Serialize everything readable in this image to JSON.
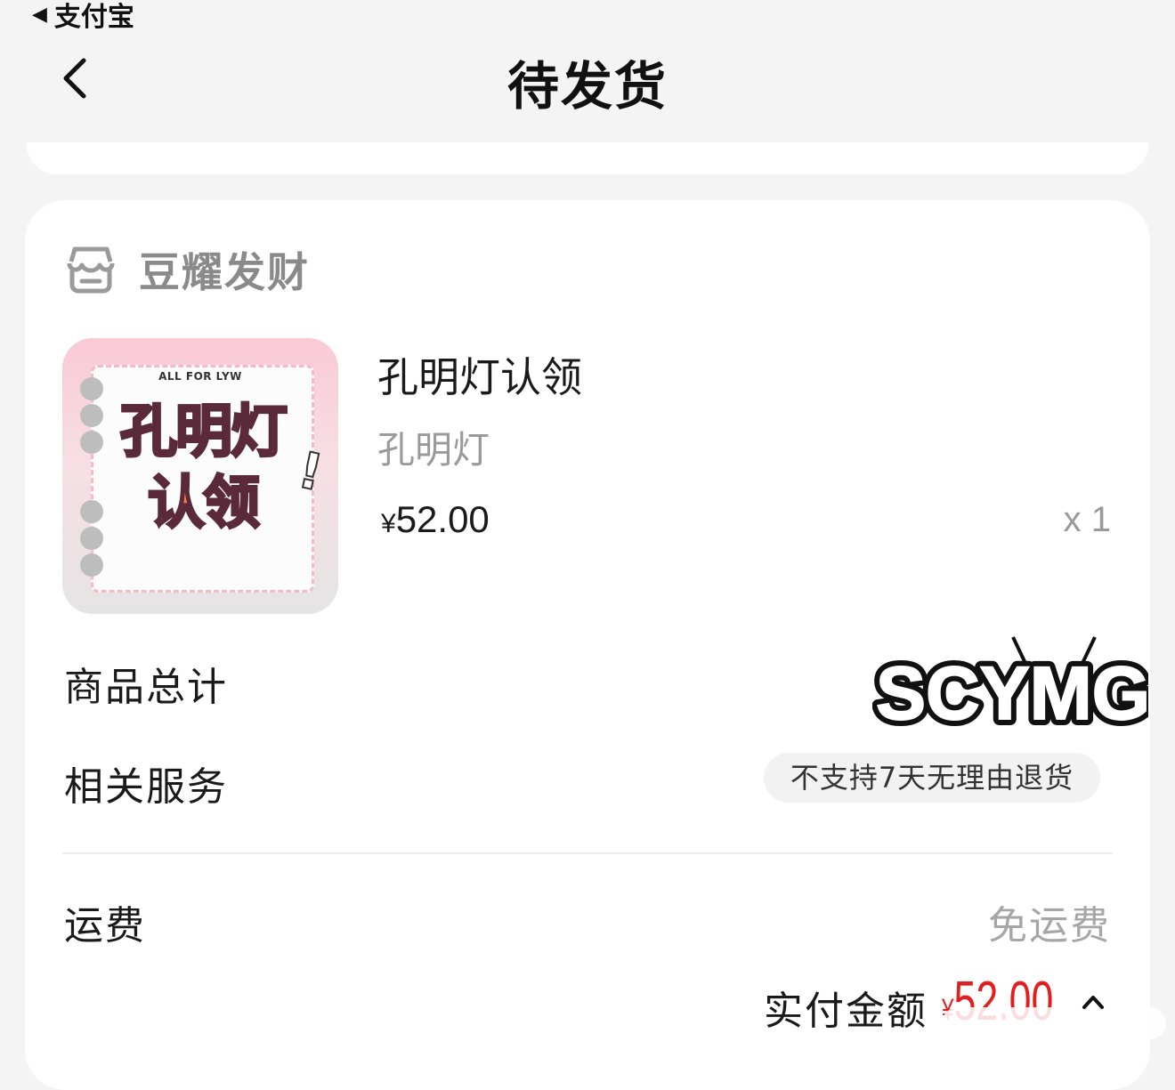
{
  "status_bar": {
    "back_app_label": "支付宝"
  },
  "header": {
    "title": "待发货"
  },
  "shop": {
    "name": "豆耀发财"
  },
  "product": {
    "image_text": {
      "tagline": "ALL FOR LYW",
      "line1": "孔明灯",
      "line2": "认领",
      "mark": "!"
    },
    "title": "孔明灯认领",
    "spec": "孔明灯",
    "price_currency": "¥",
    "price": "52.00",
    "quantity": "x 1"
  },
  "summary": {
    "goods_total_label": "商品总计",
    "watermark_text": "SCYMG",
    "service_label": "相关服务",
    "service_badge": "不支持7天无理由退货",
    "shipping_label": "运费",
    "shipping_value": "免运费",
    "paid_label": "实付金额",
    "paid_currency": "¥",
    "paid_amount": "52.00"
  },
  "colors": {
    "price_red": "#e02020",
    "muted_gray": "#9a9a9a"
  },
  "icons": [
    "back-arrow-icon",
    "store-icon",
    "chevron-up-icon"
  ]
}
